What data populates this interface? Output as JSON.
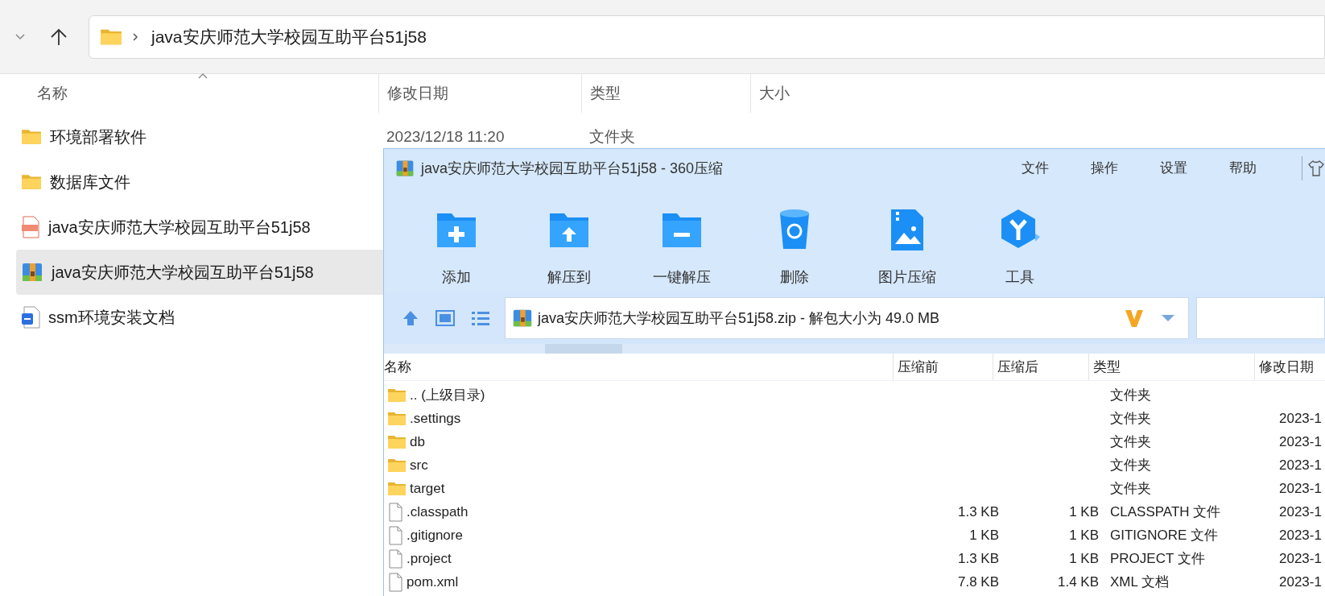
{
  "explorer": {
    "address": {
      "path": "java安庆师范大学校园互助平台51j58"
    },
    "columns": [
      {
        "label": "名称"
      },
      {
        "label": "修改日期"
      },
      {
        "label": "类型"
      },
      {
        "label": "大小"
      }
    ],
    "rows": [
      {
        "name": "环境部署软件",
        "kind": "folder",
        "selected": false,
        "date": "2023/12/18 11:20",
        "type": "文件夹"
      },
      {
        "name": "数据库文件",
        "kind": "folder",
        "selected": false
      },
      {
        "name": "java安庆师范大学校园互助平台51j58",
        "kind": "video",
        "selected": false
      },
      {
        "name": "java安庆师范大学校园互助平台51j58",
        "kind": "archive",
        "selected": true
      },
      {
        "name": "ssm环境安装文档",
        "kind": "doc",
        "selected": false
      }
    ]
  },
  "archiver": {
    "title": "java安庆师范大学校园互助平台51j58 - 360压缩",
    "menu": [
      "文件",
      "操作",
      "设置",
      "帮助"
    ],
    "tools": [
      {
        "label": "添加",
        "kind": "add"
      },
      {
        "label": "解压到",
        "kind": "extract"
      },
      {
        "label": "一键解压",
        "kind": "oneclick"
      },
      {
        "label": "删除",
        "kind": "delete"
      },
      {
        "label": "图片压缩",
        "kind": "image"
      },
      {
        "label": "工具",
        "kind": "tools"
      }
    ],
    "path_bar": {
      "text": "java安庆师范大学校园互助平台51j58.zip - 解包大小为 49.0 MB"
    },
    "columns": [
      {
        "label": "名称"
      },
      {
        "label": "压缩前"
      },
      {
        "label": "压缩后"
      },
      {
        "label": "类型"
      },
      {
        "label": "修改日期"
      }
    ],
    "rows": [
      {
        "name": ".. (上级目录)",
        "kind": "folder",
        "type": "文件夹"
      },
      {
        "name": ".settings",
        "kind": "folder",
        "type": "文件夹",
        "date": "2023-1"
      },
      {
        "name": "db",
        "kind": "folder",
        "type": "文件夹",
        "date": "2023-1"
      },
      {
        "name": "src",
        "kind": "folder",
        "type": "文件夹",
        "date": "2023-1"
      },
      {
        "name": "target",
        "kind": "folder",
        "type": "文件夹",
        "date": "2023-1"
      },
      {
        "name": ".classpath",
        "kind": "file",
        "before": "1.3 KB",
        "after": "1 KB",
        "type": "CLASSPATH 文件",
        "date": "2023-1"
      },
      {
        "name": ".gitignore",
        "kind": "file",
        "before": "1 KB",
        "after": "1 KB",
        "type": "GITIGNORE 文件",
        "date": "2023-1"
      },
      {
        "name": ".project",
        "kind": "file",
        "before": "1.3 KB",
        "after": "1 KB",
        "type": "PROJECT 文件",
        "date": "2023-1"
      },
      {
        "name": "pom.xml",
        "kind": "file",
        "before": "7.8 KB",
        "after": "1.4 KB",
        "type": "XML 文档",
        "date": "2023-1"
      }
    ]
  }
}
